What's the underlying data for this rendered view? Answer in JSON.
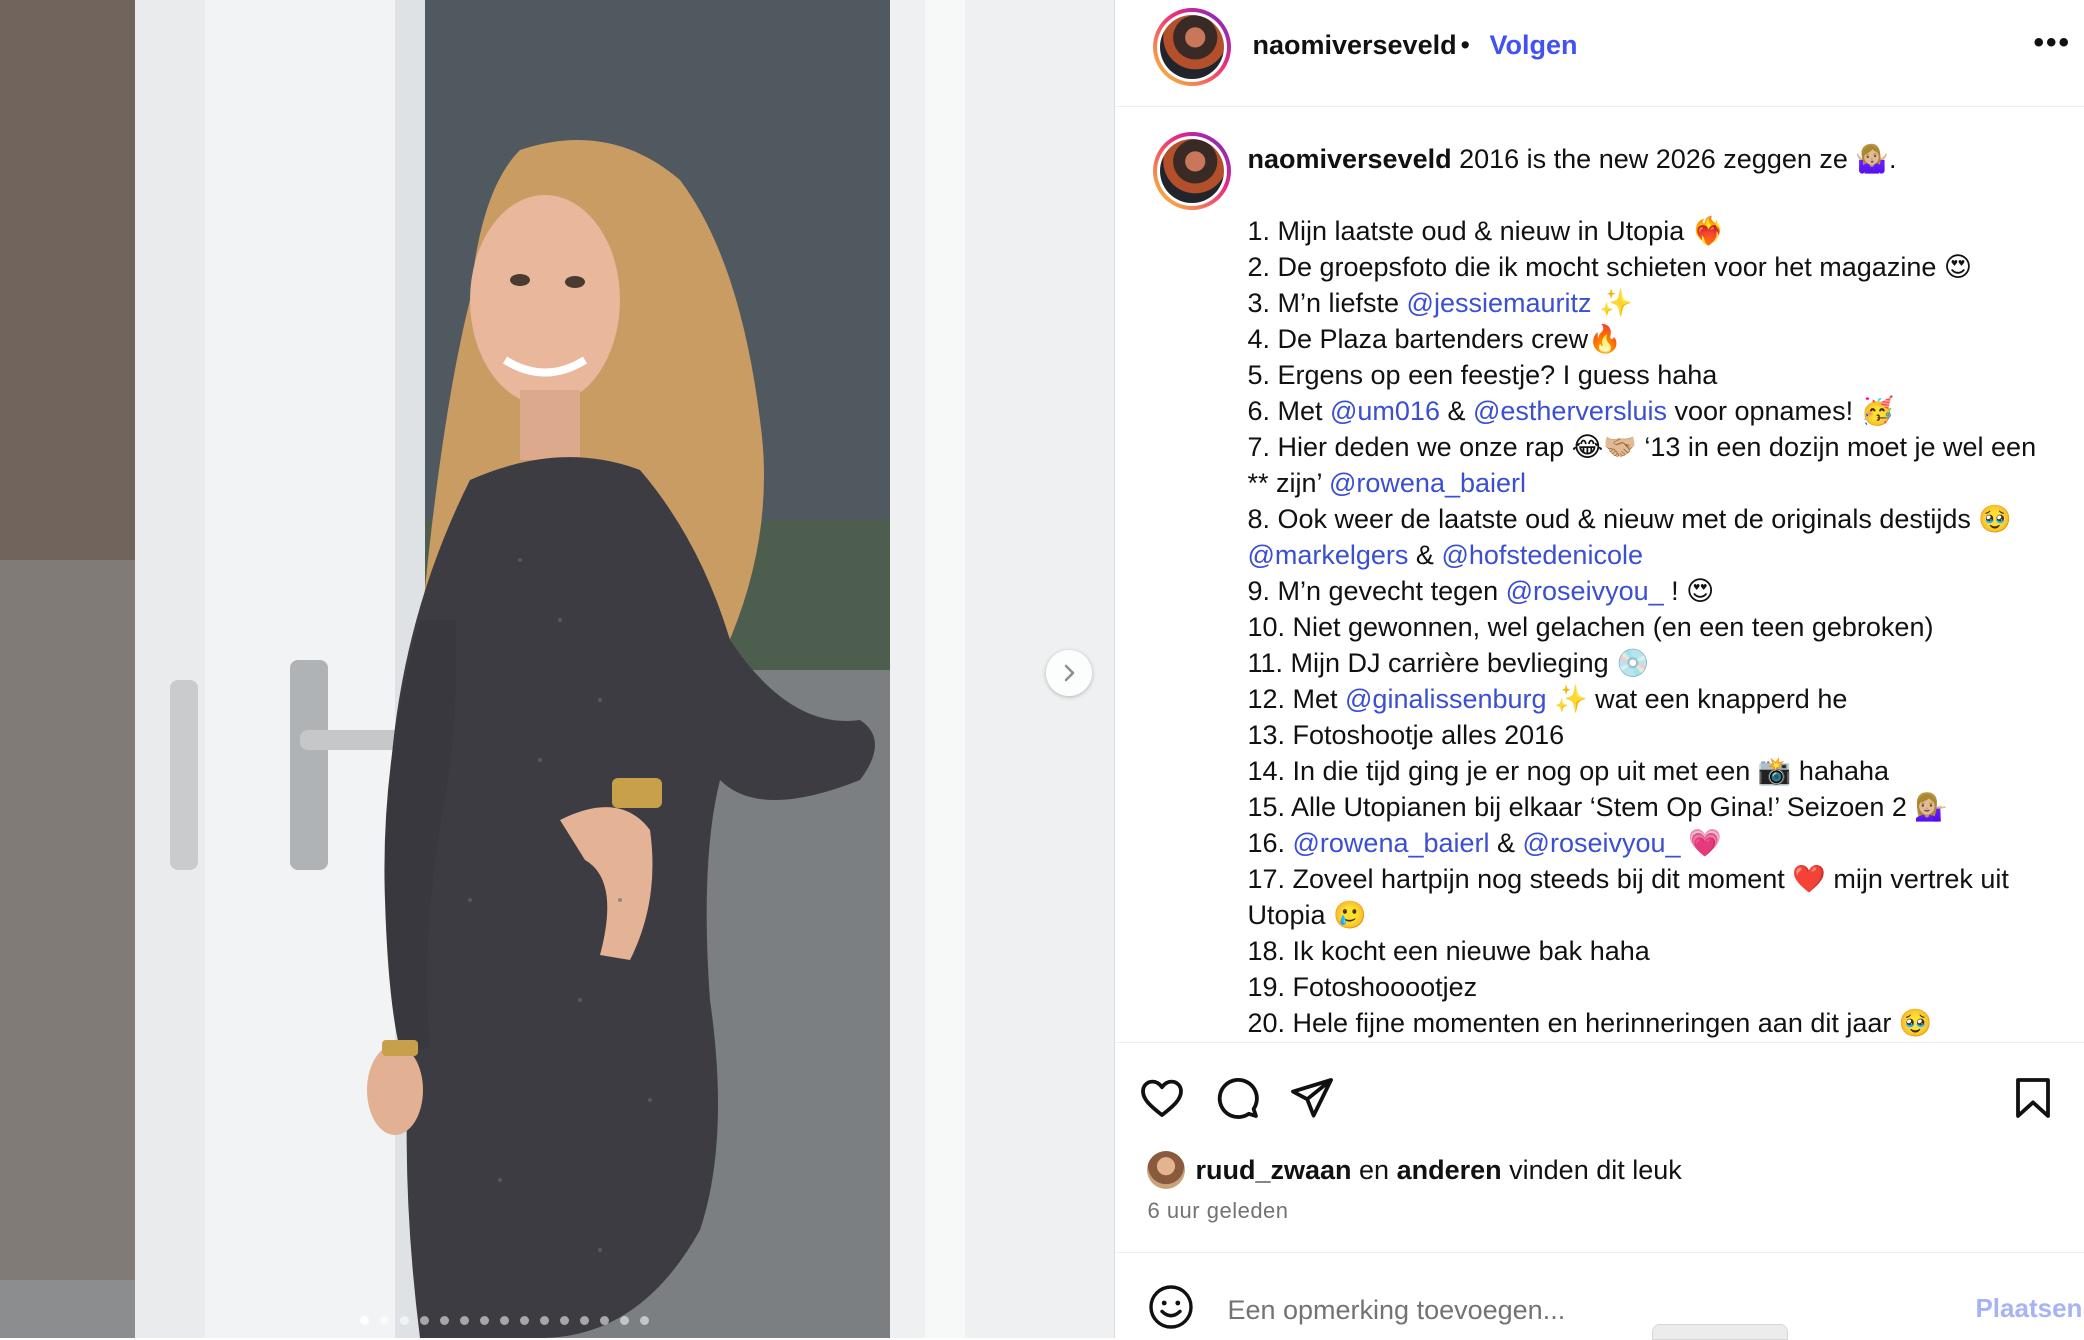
{
  "header": {
    "username": "naomiverseveld",
    "separator": "•",
    "follow_label": "Volgen",
    "more_label": "•••"
  },
  "caption": {
    "username": "naomiverseveld",
    "intro": "2016 is the new 2026 zeggen ze 🤷🏼‍♀️.",
    "lines": [
      [
        {
          "t": "1. Mijn laatste oud & nieuw in Utopia ❤️‍🔥"
        }
      ],
      [
        {
          "t": "2. De groepsfoto die ik mocht schieten voor het magazine 😍"
        }
      ],
      [
        {
          "t": "3. M’n liefste "
        },
        {
          "t": "@jessiemauritz",
          "mention": true
        },
        {
          "t": " ✨"
        }
      ],
      [
        {
          "t": "4. De Plaza bartenders crew🔥"
        }
      ],
      [
        {
          "t": "5. Ergens op een feestje? I guess haha"
        }
      ],
      [
        {
          "t": "6. Met "
        },
        {
          "t": "@um016",
          "mention": true
        },
        {
          "t": " & "
        },
        {
          "t": "@estherversluis",
          "mention": true
        },
        {
          "t": " voor opnames! 🥳"
        }
      ],
      [
        {
          "t": "7. Hier deden we onze rap 😂🤝🏼 ‘13 in een dozijn moet je wel een ** zijn’ "
        },
        {
          "t": "@rowena_baierl",
          "mention": true
        }
      ],
      [
        {
          "t": "8. Ook weer de laatste oud & nieuw met de originals destijds 🥹 "
        },
        {
          "t": "@markelgers",
          "mention": true
        },
        {
          "t": " & "
        },
        {
          "t": "@hofstedenicole",
          "mention": true
        }
      ],
      [
        {
          "t": "9. M’n gevecht tegen "
        },
        {
          "t": "@roseivyou_",
          "mention": true
        },
        {
          "t": " ! 😍"
        }
      ],
      [
        {
          "t": "10. Niet gewonnen, wel gelachen (en een teen gebroken)"
        }
      ],
      [
        {
          "t": "11. Mijn DJ carrière bevlieging 💿"
        }
      ],
      [
        {
          "t": "12. Met "
        },
        {
          "t": "@ginalissenburg",
          "mention": true
        },
        {
          "t": " ✨ wat een knapperd he"
        }
      ],
      [
        {
          "t": "13. Fotoshootje alles 2016"
        }
      ],
      [
        {
          "t": "14. In die tijd ging je er nog op uit met een 📸 hahaha"
        }
      ],
      [
        {
          "t": "15. Alle Utopianen bij elkaar ‘Stem Op Gina!’ Seizoen 2 💁🏼‍♀️"
        }
      ],
      [
        {
          "t": "16. "
        },
        {
          "t": "@rowena_baierl",
          "mention": true
        },
        {
          "t": " & "
        },
        {
          "t": "@roseivyou_",
          "mention": true
        },
        {
          "t": " 💗"
        }
      ],
      [
        {
          "t": "17. Zoveel hartpijn nog steeds bij dit moment ❤️ mijn vertrek uit Utopia 🥲"
        }
      ],
      [
        {
          "t": "18. Ik kocht een nieuwe bak haha"
        }
      ],
      [
        {
          "t": "19. Fotoshooootjez"
        }
      ],
      [
        {
          "t": "20. Hele fijne momenten en herinneringen aan dit jaar 🥹"
        }
      ]
    ]
  },
  "likes": {
    "user": "ruud_zwaan",
    "connector": "en",
    "others": "anderen",
    "suffix": "vinden dit leuk"
  },
  "timestamp": "6 uur geleden",
  "comment": {
    "placeholder": "Een opmerking toevoegen...",
    "post_label": "Plaatsen"
  },
  "carousel": {
    "slide_count": 15,
    "active_index": 0
  },
  "icons": [
    "heart-icon",
    "comment-icon",
    "share-icon",
    "bookmark-icon",
    "emoji-icon",
    "chevron-right-icon",
    "more-icon"
  ],
  "colors": {
    "accent": "#4150f7",
    "mention": "#3a4fd1",
    "post_disabled": "#a8b3f7",
    "muted": "#737373"
  }
}
